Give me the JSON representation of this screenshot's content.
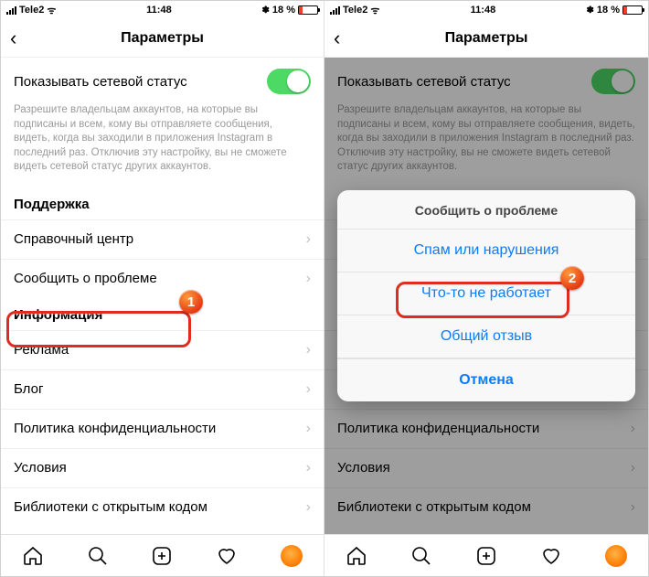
{
  "status": {
    "carrier": "Tele2",
    "wifi_glyph": "ᯤ",
    "time": "11:48",
    "bt_glyph": "✽",
    "battery_text": "18 %"
  },
  "nav": {
    "title": "Параметры"
  },
  "network_status": {
    "label": "Показывать сетевой статус",
    "hint": "Разрешите владельцам аккаунтов, на которые вы подписаны и всем, кому вы отправляете сообщения, видеть, когда вы заходили в приложения Instagram в последний раз. Отключив эту настройку, вы не сможете видеть сетевой статус других аккаунтов."
  },
  "support": {
    "header": "Поддержка",
    "help_center": "Справочный центр",
    "report_problem": "Сообщить о проблеме"
  },
  "info": {
    "header": "Информация",
    "ads": "Реклама",
    "blog": "Блог",
    "privacy": "Политика конфиденциальности",
    "terms": "Условия",
    "opensource": "Библиотеки с открытым кодом"
  },
  "sheet": {
    "title": "Сообщить о проблеме",
    "spam": "Спам или нарушения",
    "broken": "Что-то не работает",
    "feedback": "Общий отзыв",
    "cancel": "Отмена"
  },
  "markers": {
    "one": "1",
    "two": "2"
  }
}
